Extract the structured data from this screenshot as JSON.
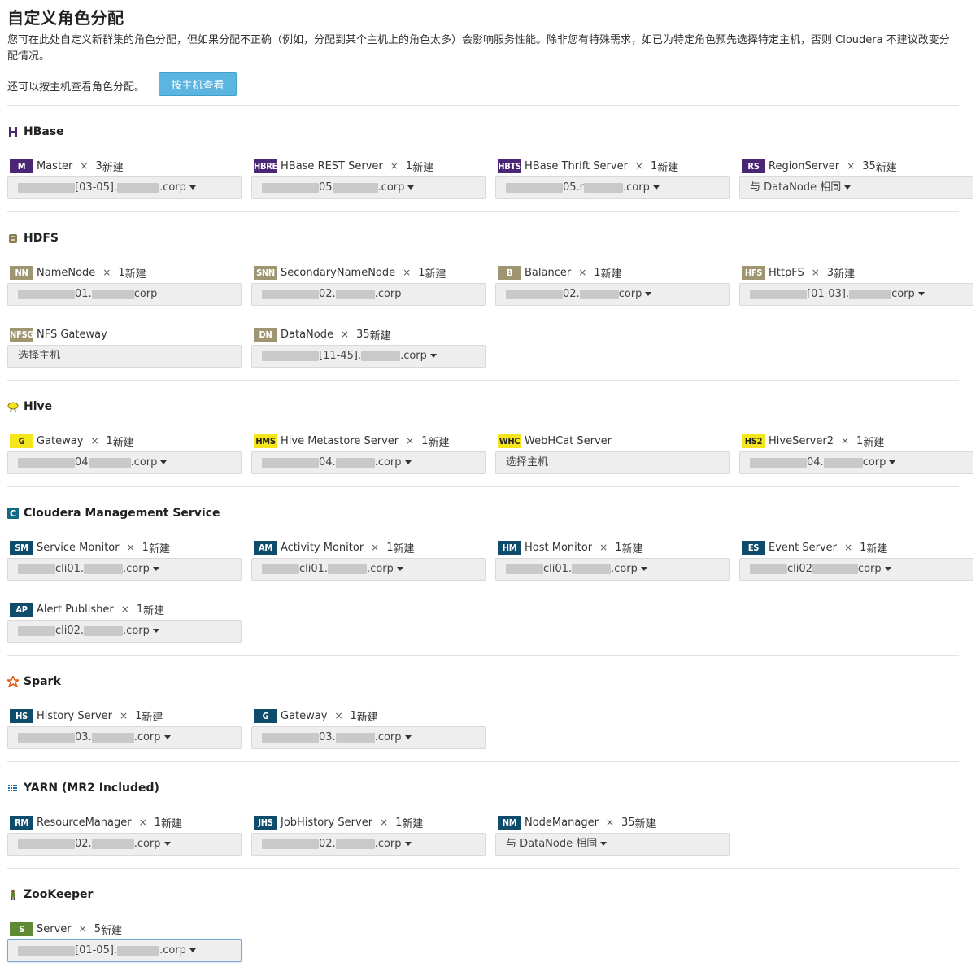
{
  "header": {
    "title": "自定义角色分配",
    "description": "您可在此处自定义新群集的角色分配，但如果分配不正确（例如，分配到某个主机上的角色太多）会影响服务性能。除非您有特殊需求，如已为特定角色预先选择特定主机，否则 Cloudera 不建议改变分配情况。",
    "by_host_text": "还可以按主机查看角色分配。",
    "by_host_button": "按主机查看"
  },
  "services": {
    "hbase": {
      "name": "HBase",
      "icon": "hbase-icon",
      "roles": [
        {
          "abbr": "M",
          "name": "Master",
          "x": "×",
          "count": "3",
          "new": "新建",
          "host": "[03-05].",
          "host2": ".corp"
        },
        {
          "abbr": "HBRE",
          "name": "HBase REST Server",
          "x": "×",
          "count": "1",
          "new": "新建",
          "host": "05",
          "host2": ".corp"
        },
        {
          "abbr": "HBTS",
          "name": "HBase Thrift Server",
          "x": "×",
          "count": "1",
          "new": "新建",
          "host": "05.r",
          "host2": ".corp"
        },
        {
          "abbr": "RS",
          "name": "RegionServer",
          "x": "×",
          "count": "35",
          "new": "新建",
          "host": "与 DataNode 相同",
          "host2": ""
        }
      ]
    },
    "hdfs": {
      "name": "HDFS",
      "icon": "hdfs-icon",
      "roles": [
        {
          "abbr": "NN",
          "name": "NameNode",
          "x": "×",
          "count": "1",
          "new": "新建",
          "host": "01.",
          "host2": "corp"
        },
        {
          "abbr": "SNN",
          "name": "SecondaryNameNode",
          "x": "×",
          "count": "1",
          "new": "新建",
          "host": "02.",
          "host2": ".corp"
        },
        {
          "abbr": "B",
          "name": "Balancer",
          "x": "×",
          "count": "1",
          "new": "新建",
          "host": "02.",
          "host2": "corp"
        },
        {
          "abbr": "HFS",
          "name": "HttpFS",
          "x": "×",
          "count": "3",
          "new": "新建",
          "host": "[01-03].",
          "host2": "corp"
        },
        {
          "abbr": "NFSG",
          "name": "NFS Gateway",
          "x": "",
          "count": "",
          "new": "",
          "host": "选择主机",
          "host2": ""
        },
        {
          "abbr": "DN",
          "name": "DataNode",
          "x": "×",
          "count": "35",
          "new": "新建",
          "host": "[11-45].",
          "host2": ".corp"
        }
      ]
    },
    "hive": {
      "name": "Hive",
      "icon": "hive-icon",
      "roles": [
        {
          "abbr": "G",
          "name": "Gateway",
          "x": "×",
          "count": "1",
          "new": "新建",
          "host": "04",
          "host2": ".corp"
        },
        {
          "abbr": "HMS",
          "name": "Hive Metastore Server",
          "x": "×",
          "count": "1",
          "new": "新建",
          "host": "04.",
          "host2": ".corp"
        },
        {
          "abbr": "WHC",
          "name": "WebHCat Server",
          "x": "",
          "count": "",
          "new": "",
          "host": "选择主机",
          "host2": ""
        },
        {
          "abbr": "HS2",
          "name": "HiveServer2",
          "x": "×",
          "count": "1",
          "new": "新建",
          "host": "04.",
          "host2": "corp"
        }
      ]
    },
    "cms": {
      "name": "Cloudera Management Service",
      "icon": "cloudera-icon",
      "roles": [
        {
          "abbr": "SM",
          "name": "Service Monitor",
          "x": "×",
          "count": "1",
          "new": "新建",
          "host": "cli01.",
          "host2": ".corp"
        },
        {
          "abbr": "AM",
          "name": "Activity Monitor",
          "x": "×",
          "count": "1",
          "new": "新建",
          "host": "cli01.",
          "host2": ".corp"
        },
        {
          "abbr": "HM",
          "name": "Host Monitor",
          "x": "×",
          "count": "1",
          "new": "新建",
          "host": "cli01.",
          "host2": ".corp"
        },
        {
          "abbr": "ES",
          "name": "Event Server",
          "x": "×",
          "count": "1",
          "new": "新建",
          "host": "cli02",
          "host2": "corp"
        },
        {
          "abbr": "AP",
          "name": "Alert Publisher",
          "x": "×",
          "count": "1",
          "new": "新建",
          "host": "cli02.",
          "host2": ".corp"
        }
      ]
    },
    "spark": {
      "name": "Spark",
      "icon": "spark-icon",
      "roles": [
        {
          "abbr": "HS",
          "name": "History Server",
          "x": "×",
          "count": "1",
          "new": "新建",
          "host": "03.",
          "host2": ".corp"
        },
        {
          "abbr": "G",
          "name": "Gateway",
          "x": "×",
          "count": "1",
          "new": "新建",
          "host": "03.",
          "host2": ".corp"
        }
      ]
    },
    "yarn": {
      "name": "YARN (MR2 Included)",
      "icon": "yarn-icon",
      "roles": [
        {
          "abbr": "RM",
          "name": "ResourceManager",
          "x": "×",
          "count": "1",
          "new": "新建",
          "host": "02.",
          "host2": ".corp"
        },
        {
          "abbr": "JHS",
          "name": "JobHistory Server",
          "x": "×",
          "count": "1",
          "new": "新建",
          "host": "02.",
          "host2": ".corp"
        },
        {
          "abbr": "NM",
          "name": "NodeManager",
          "x": "×",
          "count": "35",
          "new": "新建",
          "host": "与 DataNode 相同",
          "host2": ""
        }
      ]
    },
    "zookeeper": {
      "name": "ZooKeeper",
      "icon": "zookeeper-icon",
      "roles": [
        {
          "abbr": "S",
          "name": "Server",
          "x": "×",
          "count": "5",
          "new": "新建",
          "host": "[01-05].",
          "host2": ".corp"
        }
      ]
    }
  },
  "colors": {
    "hbase": "#4a2675",
    "hdfs": "#a09571",
    "hive": "#f5e51b",
    "cms": "#0f4c6b",
    "spark": "#0f4c6b",
    "yarn": "#0f4c6b",
    "zookeeper": "#5d8a32",
    "button": "#5bb5e0"
  }
}
